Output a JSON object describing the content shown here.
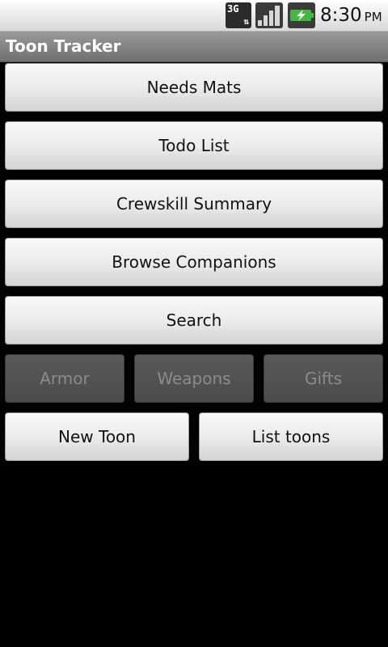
{
  "status_bar": {
    "network_label": "3G",
    "network_arrows": "⇅",
    "time": "8:30",
    "ampm": "PM",
    "signal_icon": "signal-bars-icon",
    "battery_icon": "battery-charging-icon",
    "battery_color": "#3fb93f"
  },
  "app": {
    "title": "Toon Tracker"
  },
  "menu": {
    "needs_mats": "Needs Mats",
    "todo_list": "Todo List",
    "crewskill_summary": "Crewskill Summary",
    "browse_companions": "Browse Companions",
    "search": "Search",
    "armor": "Armor",
    "weapons": "Weapons",
    "gifts": "Gifts",
    "new_toon": "New Toon",
    "list_toons": "List toons"
  }
}
